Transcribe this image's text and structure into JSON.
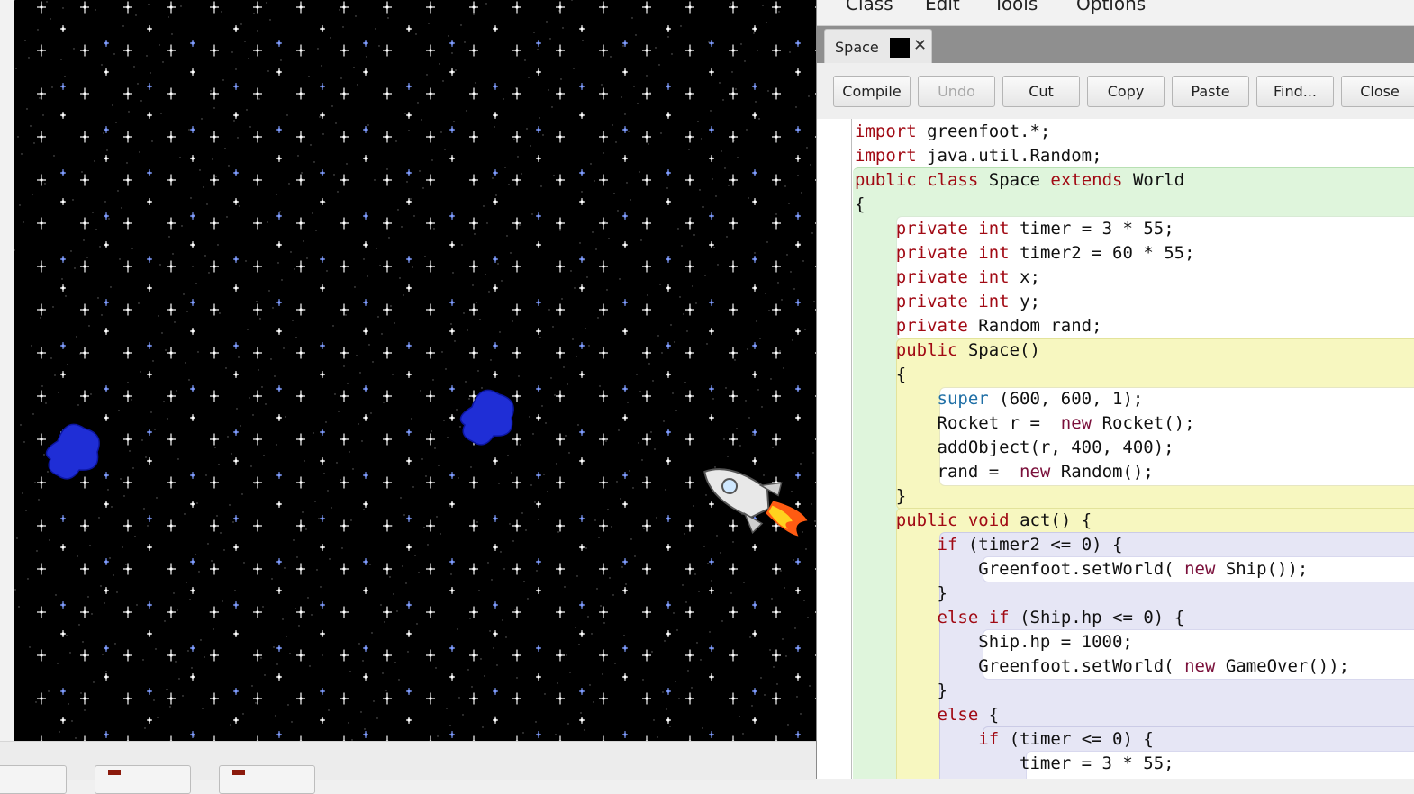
{
  "menu": [
    "Class",
    "Edit",
    "Tools",
    "Options"
  ],
  "tab": {
    "label": "Space",
    "close": "✕"
  },
  "toolbar": {
    "buttons": [
      {
        "label": "Compile",
        "enabled": true
      },
      {
        "label": "Undo",
        "enabled": false
      },
      {
        "label": "Cut",
        "enabled": true
      },
      {
        "label": "Copy",
        "enabled": true
      },
      {
        "label": "Paste",
        "enabled": true
      },
      {
        "label": "Find...",
        "enabled": true
      },
      {
        "label": "Close",
        "enabled": true
      }
    ]
  },
  "code": {
    "lines": [
      [
        [
          "kw",
          "import"
        ],
        [
          "",
          "greenfoot.*;"
        ]
      ],
      [
        [
          "kw",
          "import"
        ],
        [
          "",
          "java.util.Random;"
        ]
      ],
      [
        [
          "kw",
          "public"
        ],
        [
          "",
          ""
        ],
        [
          "kw",
          "class"
        ],
        [
          "",
          "Space"
        ],
        [
          "kw",
          "extends"
        ],
        [
          "",
          "World"
        ]
      ],
      [
        [
          "",
          "{"
        ]
      ],
      [
        [
          "",
          "    "
        ],
        [
          "kw",
          "private"
        ],
        [
          "ty",
          "int"
        ],
        [
          "",
          "timer = 3 * 55;"
        ]
      ],
      [
        [
          "",
          "    "
        ],
        [
          "kw",
          "private"
        ],
        [
          "ty",
          "int"
        ],
        [
          "",
          "timer2 = 60 * 55;"
        ]
      ],
      [
        [
          "",
          "    "
        ],
        [
          "kw",
          "private"
        ],
        [
          "ty",
          "int"
        ],
        [
          "",
          "x;"
        ]
      ],
      [
        [
          "",
          "    "
        ],
        [
          "kw",
          "private"
        ],
        [
          "ty",
          "int"
        ],
        [
          "",
          "y;"
        ]
      ],
      [
        [
          "",
          "    "
        ],
        [
          "kw",
          "private"
        ],
        [
          "",
          "Random rand;"
        ]
      ],
      [
        [
          "",
          "    "
        ],
        [
          "kw",
          "public"
        ],
        [
          "",
          "Space()"
        ]
      ],
      [
        [
          "",
          "    {"
        ]
      ],
      [
        [
          "",
          "        "
        ],
        [
          "sp",
          "super"
        ],
        [
          "",
          "(600, 600, 1);"
        ]
      ],
      [
        [
          "",
          "        Rocket r = "
        ],
        [
          "nw",
          "new"
        ],
        [
          "",
          "Rocket();"
        ]
      ],
      [
        [
          "",
          "        addObject(r, 400, 400);"
        ]
      ],
      [
        [
          "",
          "        rand = "
        ],
        [
          "nw",
          "new"
        ],
        [
          "",
          "Random();"
        ]
      ],
      [
        [
          "",
          "    }"
        ]
      ],
      [
        [
          "",
          "    "
        ],
        [
          "kw",
          "public"
        ],
        [
          "ty",
          "void"
        ],
        [
          "",
          "act() {"
        ]
      ],
      [
        [
          "",
          "        "
        ],
        [
          "kw",
          "if"
        ],
        [
          "",
          "(timer2 <= 0) {"
        ]
      ],
      [
        [
          "",
          "            Greenfoot.setWorld("
        ],
        [
          "nw",
          "new"
        ],
        [
          "",
          "Ship());"
        ]
      ],
      [
        [
          "",
          "        }"
        ]
      ],
      [
        [
          "",
          "        "
        ],
        [
          "kw",
          "else"
        ],
        [
          "kw",
          "if"
        ],
        [
          "",
          "(Ship.hp <= 0) {"
        ]
      ],
      [
        [
          "",
          "            Ship.hp = 1000;"
        ]
      ],
      [
        [
          "",
          "            Greenfoot.setWorld("
        ],
        [
          "nw",
          "new"
        ],
        [
          "",
          "GameOver());"
        ]
      ],
      [
        [
          "",
          "        }"
        ]
      ],
      [
        [
          "",
          "        "
        ],
        [
          "kw",
          "else"
        ],
        [
          "",
          "{"
        ]
      ],
      [
        [
          "",
          "            "
        ],
        [
          "kw",
          "if"
        ],
        [
          "",
          "(timer <= 0) {"
        ]
      ],
      [
        [
          "",
          "                timer = 3 * 55;"
        ]
      ]
    ]
  },
  "world": {
    "background": "#000000",
    "star_color": "#ffffff",
    "blue_star_color": "#7f9cff",
    "asteroid_color": "#1f2ed6"
  },
  "colors": {
    "keyword": "#a10a14",
    "super": "#1f6fa6",
    "new": "#7a0f3a",
    "class_scope": "#dff5dc",
    "method_scope": "#f7f7c0",
    "block_scope": "#e6e6f5"
  }
}
